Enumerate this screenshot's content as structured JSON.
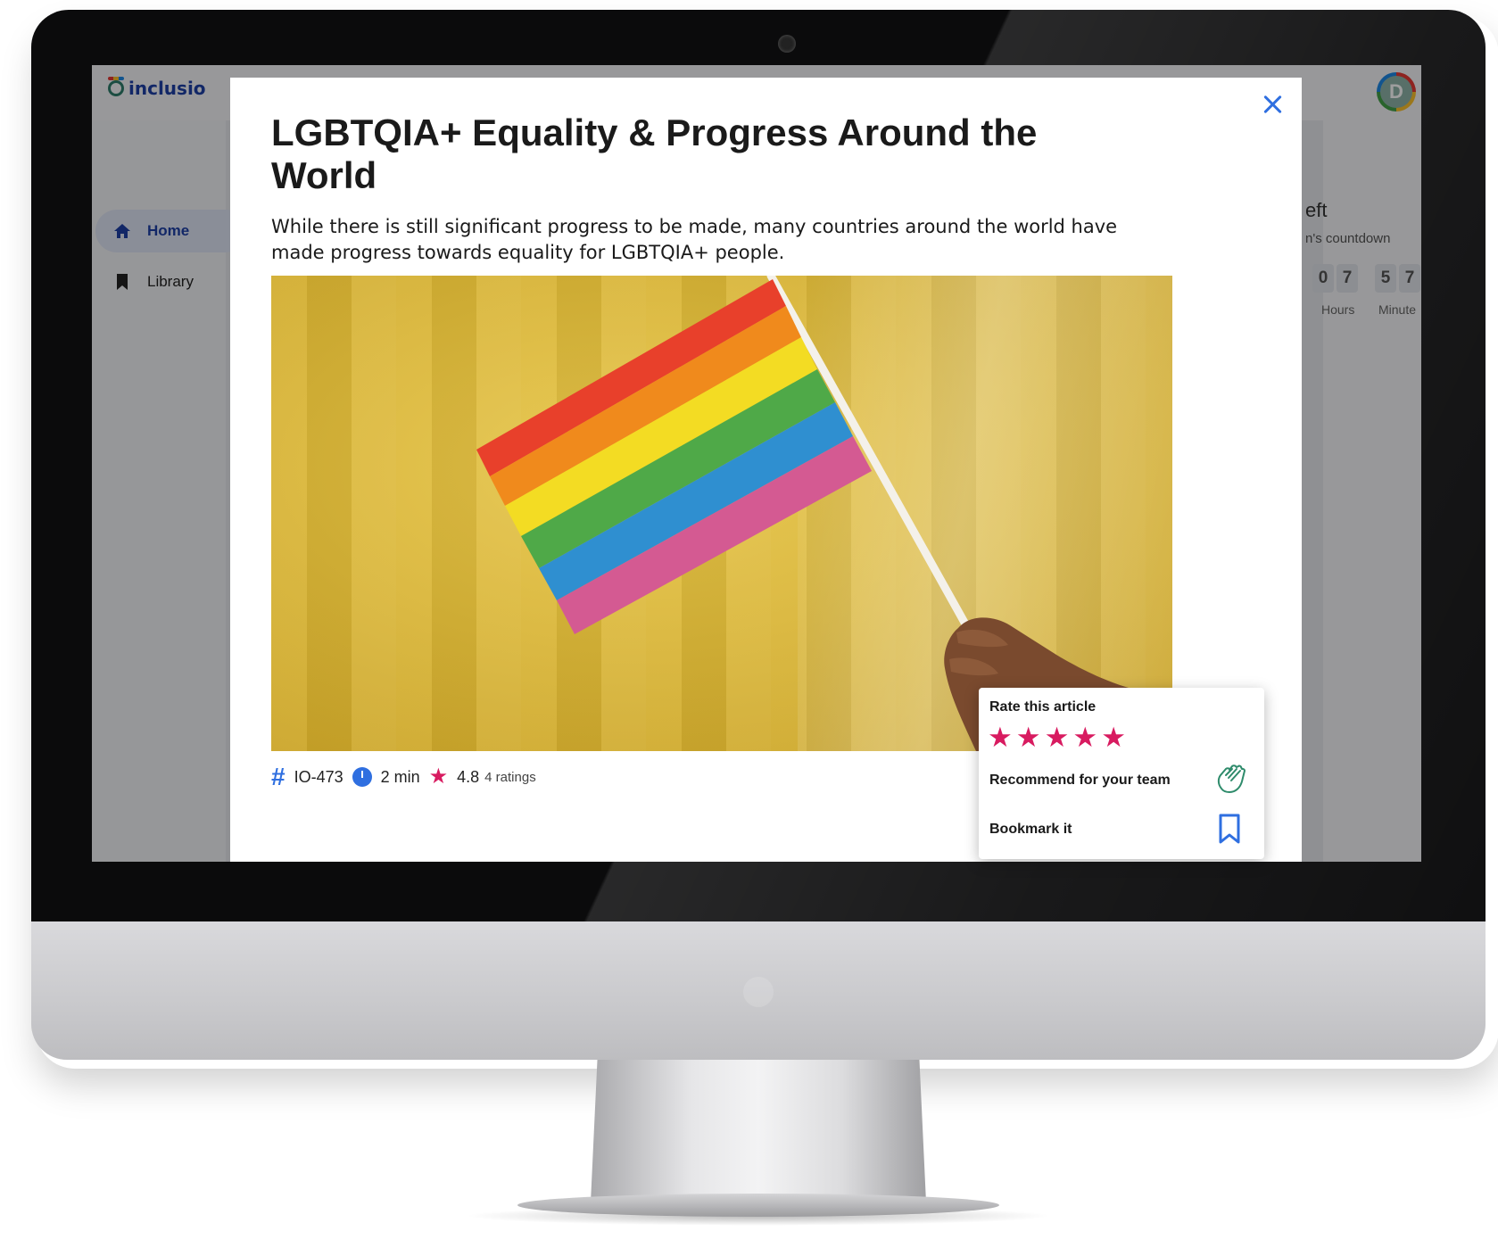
{
  "app": {
    "logo_text": "inclusio",
    "avatar_initial": "D",
    "nav": [
      {
        "label": "Home",
        "icon": "home-icon",
        "active": true
      },
      {
        "label": "Library",
        "icon": "bookmark-icon",
        "active": false
      }
    ],
    "right_panel": {
      "title": "eft",
      "subtitle": "n's countdown",
      "hours_digits": [
        "0",
        "7"
      ],
      "minutes_digits": [
        "5",
        "7"
      ],
      "hours_label": "Hours",
      "minutes_label": "Minute"
    }
  },
  "modal": {
    "close_icon": "close-icon",
    "title": "LGBTQIA+ Equality & Progress Around the World",
    "description": "While there is still significant progress to be made, many countries around the world have made progress towards equality for LGBTQIA+ people.",
    "image_alt": "Hand holding a rainbow pride flag against a gold background",
    "meta": {
      "id": "IO-473",
      "duration": "2 min",
      "rating": "4.8",
      "ratings_count": "4 ratings"
    }
  },
  "rating_popup": {
    "title": "Rate this article",
    "stars": 5,
    "recommend_label": "Recommend for your team",
    "recommend_icon": "clapping-hands-icon",
    "bookmark_label": "Bookmark it",
    "bookmark_icon": "bookmark-icon"
  },
  "colors": {
    "brand_blue": "#1d3fa6",
    "accent_blue": "#2f6fe0",
    "star_pink": "#d81b60",
    "recommend_green": "#2e8b6b"
  }
}
